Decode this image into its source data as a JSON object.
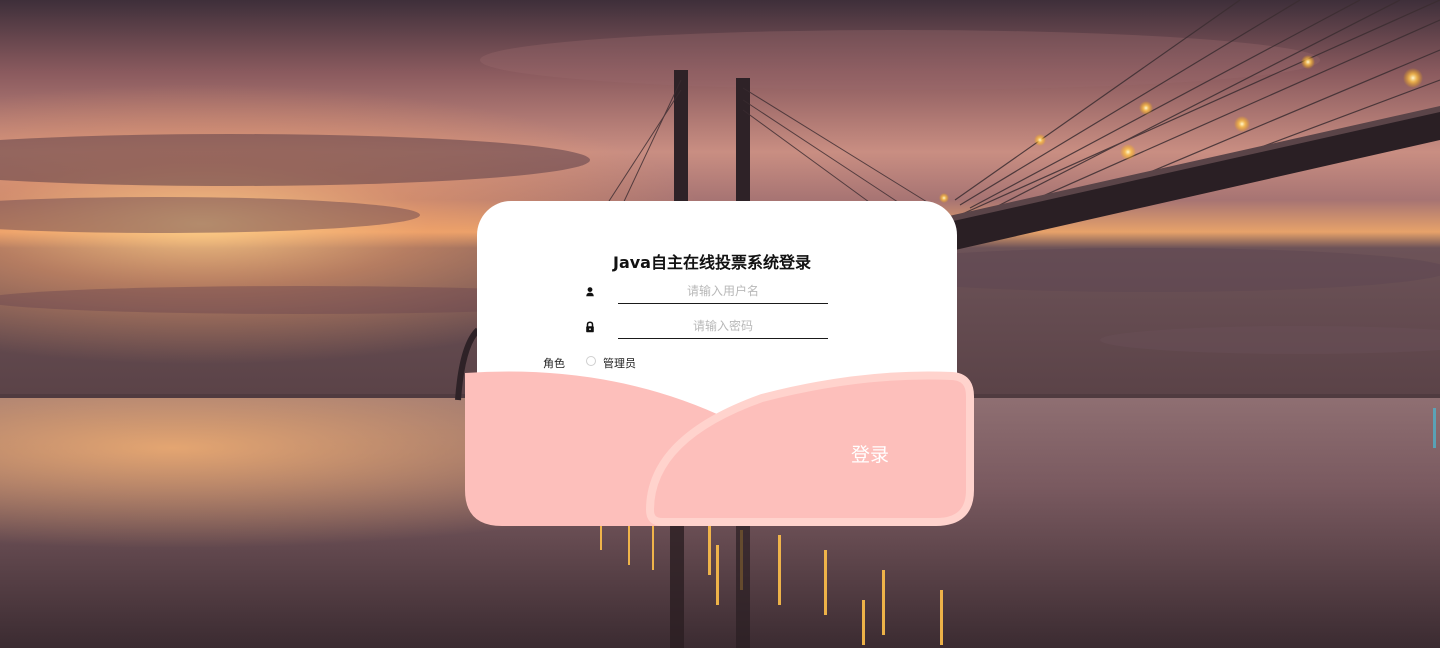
{
  "title": "Java自主在线投票系统登录",
  "username": {
    "placeholder": "请输入用户名",
    "value": ""
  },
  "password": {
    "placeholder": "请输入密码",
    "value": ""
  },
  "role": {
    "label": "角色",
    "option": "管理员",
    "selected": false
  },
  "login_button": "登录",
  "colors": {
    "card": "#ffffff",
    "wave_pink": "#fdbfbb",
    "wave_border": "#ffd6cf",
    "underline": "#1a1a1a",
    "placeholder": "#b8b8b8"
  },
  "icons": {
    "username": "user-icon",
    "password": "lock-icon"
  }
}
